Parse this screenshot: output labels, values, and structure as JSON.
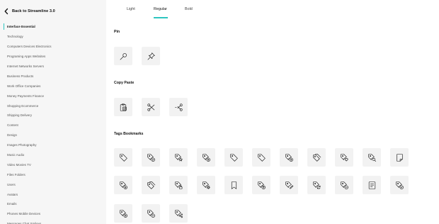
{
  "sidebar": {
    "back_label": "Back to Streamline 3.0",
    "items": [
      {
        "label": "Interface Essential",
        "active": true
      },
      {
        "label": "Technology"
      },
      {
        "label": "Computers Devices Electronics"
      },
      {
        "label": "Programing Apps Websites"
      },
      {
        "label": "Internet Networks Servers"
      },
      {
        "label": "Business Products"
      },
      {
        "label": "Work Office Companies"
      },
      {
        "label": "Money Payments Finance"
      },
      {
        "label": "Shopping Ecommerce"
      },
      {
        "label": "Shipping Delivery"
      },
      {
        "label": "Content"
      },
      {
        "label": "Design"
      },
      {
        "label": "Images Photography"
      },
      {
        "label": "Music Audio"
      },
      {
        "label": "Video Movies TV"
      },
      {
        "label": "Files Folders"
      },
      {
        "label": "Users"
      },
      {
        "label": "Avatars"
      },
      {
        "label": "Emails"
      },
      {
        "label": "Phones Mobile Devices"
      },
      {
        "label": "Messages Chat Smileys"
      }
    ]
  },
  "tabs": [
    {
      "label": "Light"
    },
    {
      "label": "Regular",
      "active": true
    },
    {
      "label": "Bold"
    }
  ],
  "sections": [
    {
      "title": "Pin",
      "icons": [
        "pin-icon",
        "pushpin-icon"
      ]
    },
    {
      "title": "Copy Paste",
      "icons": [
        "clipboard-icon",
        "scissors-icon",
        "scissors-cut-icon"
      ]
    },
    {
      "title": "Tags Bookmarks",
      "icons": [
        "tag-icon",
        "tag-check-icon",
        "tag-star-icon",
        "tag-add-icon",
        "tag-icon",
        "tag-icon",
        "tag-add-icon",
        "tags-icon",
        "tag-favorite-icon",
        "tag-search-icon",
        "bookmark-tag-icon",
        "tag-download-icon",
        "tags-icon",
        "tag-lock-icon",
        "tag-settings-icon",
        "bookmark-icon",
        "tag-upload-icon",
        "tag-edit-icon",
        "tag-refresh-icon",
        "tag-remove-icon",
        "tag-document-icon",
        "tag-check-icon",
        "tag-add-icon",
        "tag-remove-icon",
        "tag-share-icon"
      ]
    }
  ],
  "accent_color": "#2ec5c0"
}
